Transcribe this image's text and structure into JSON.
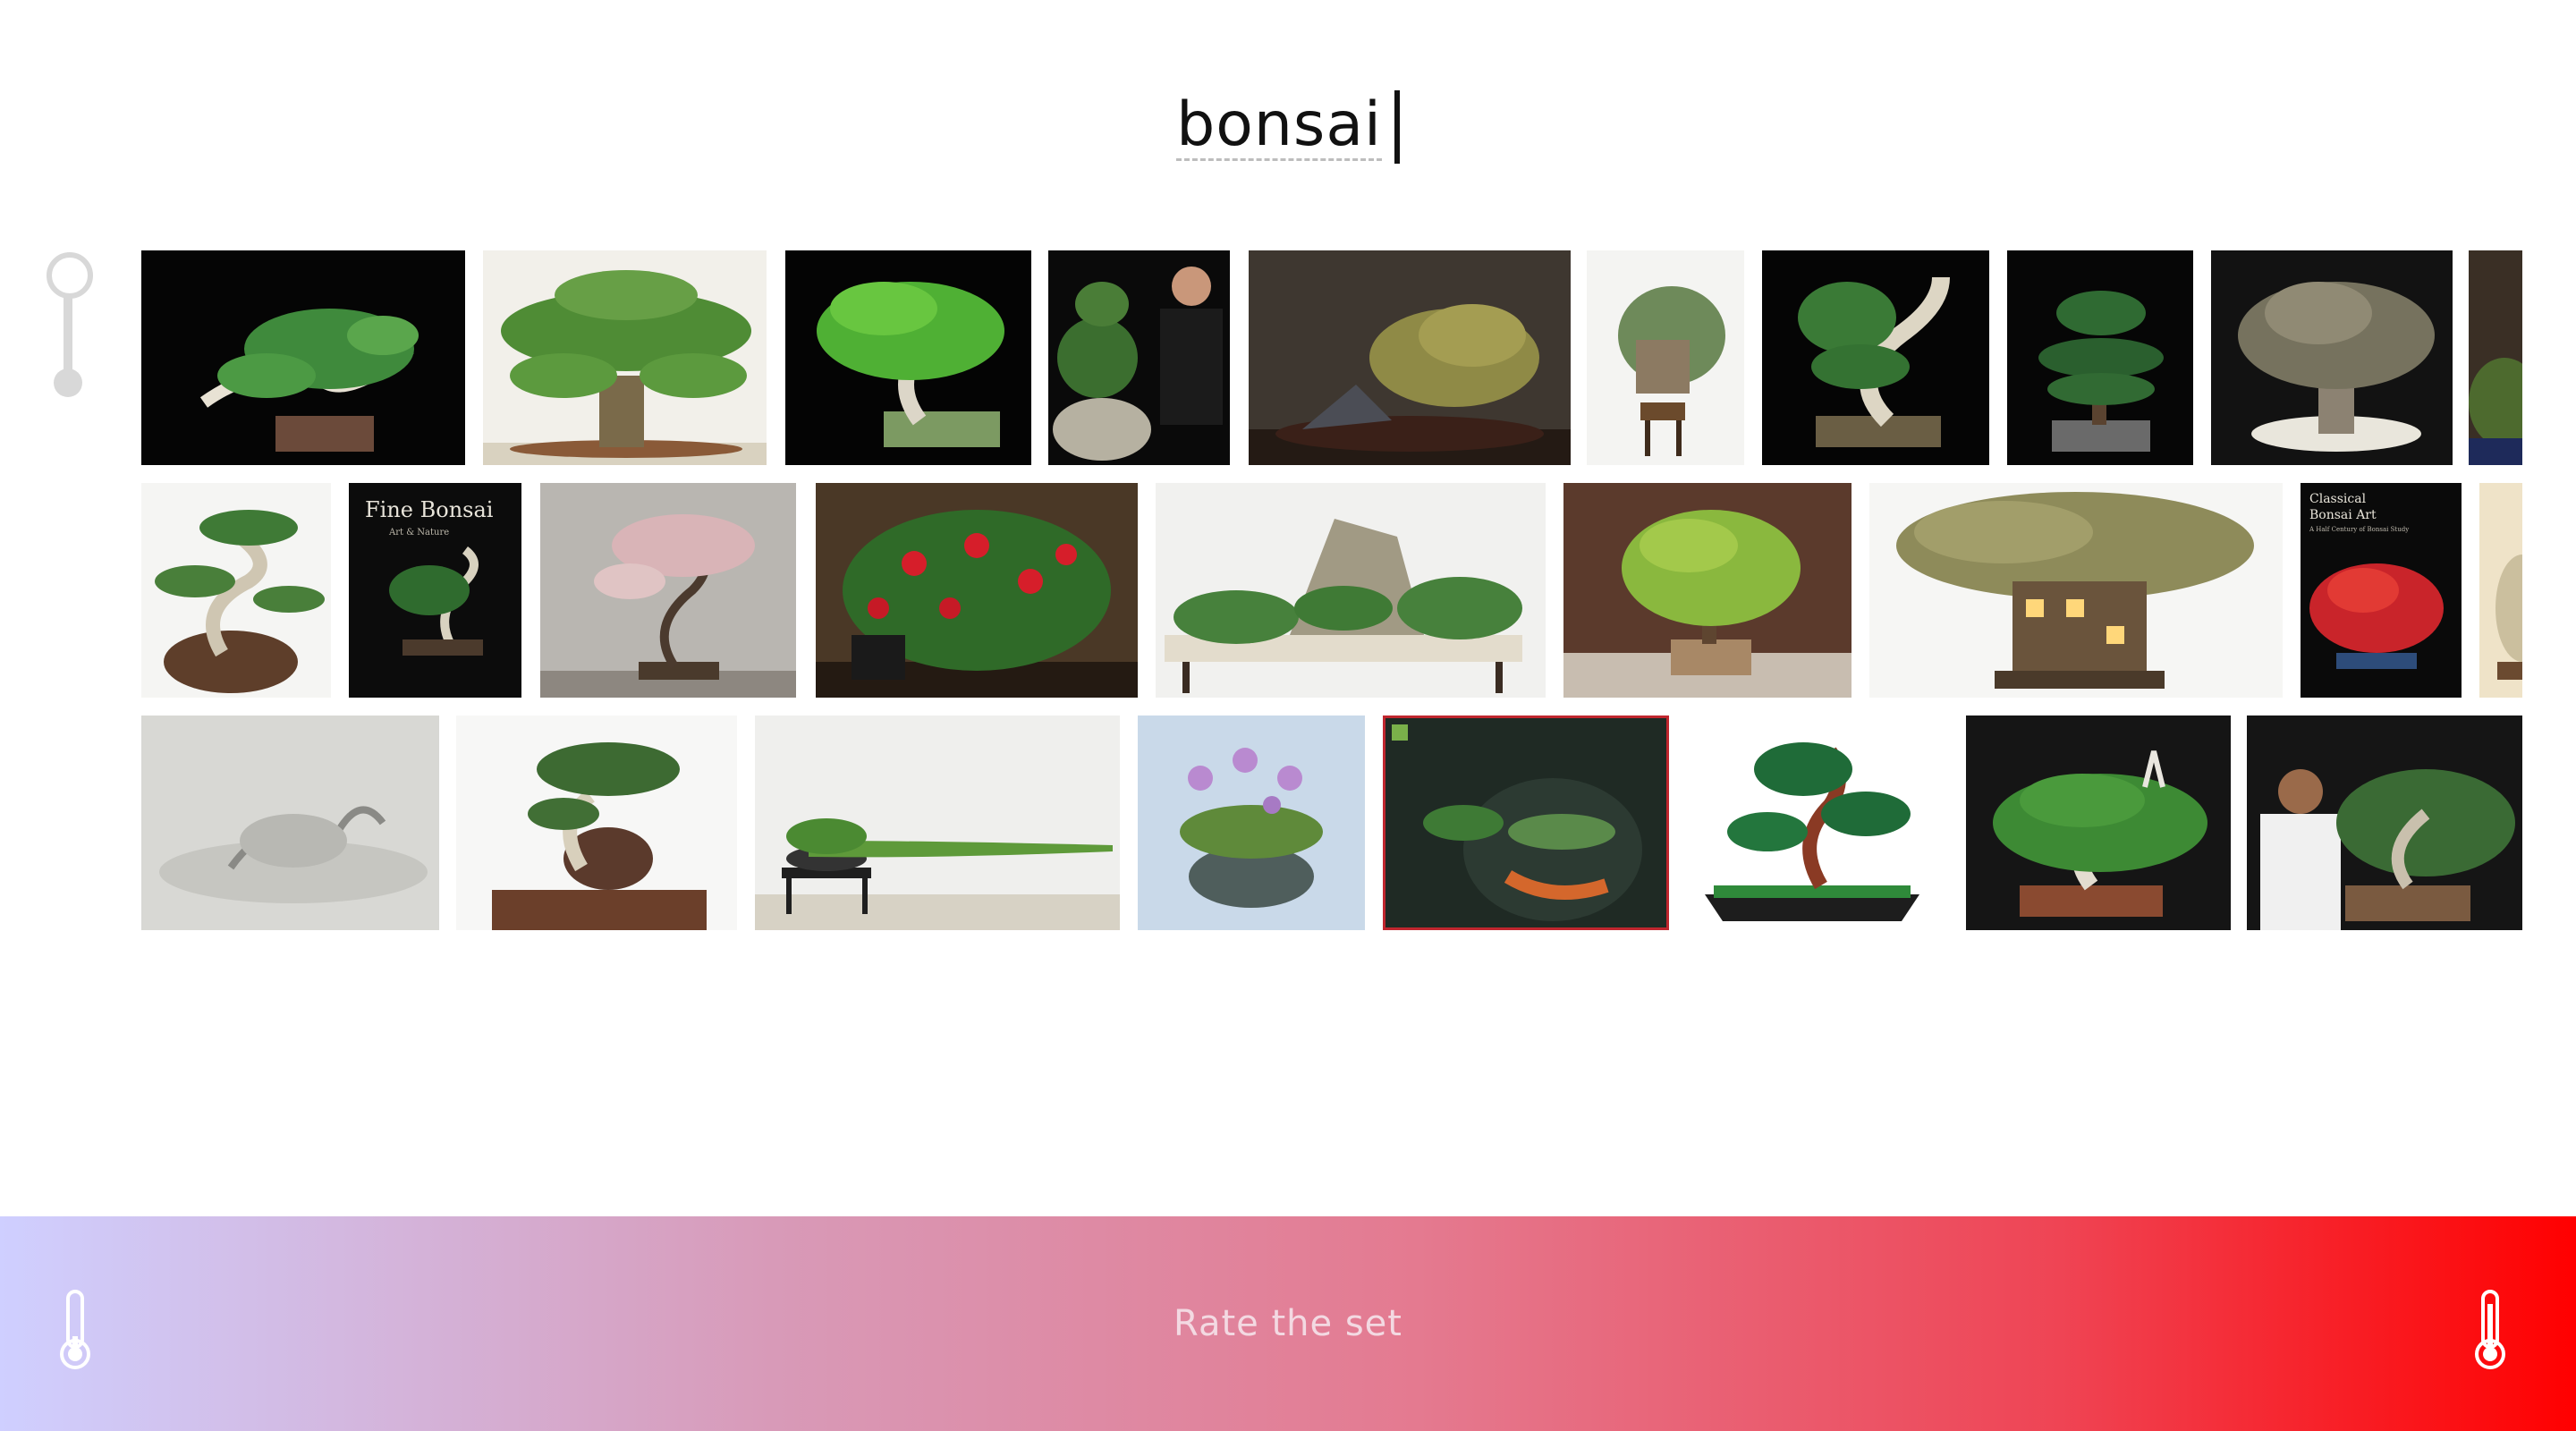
{
  "search": {
    "query": "bonsai"
  },
  "footer": {
    "label": "Rate the set"
  },
  "book_covers": {
    "fine_bonsai": {
      "title": "Fine Bonsai",
      "subtitle": "Art & Nature"
    },
    "classical": {
      "title_line1": "Classical",
      "title_line2": "Bonsai Art",
      "subtitle": "A Half Century of Bonsai Study"
    }
  },
  "colors": {
    "gradient_start": "#cfcfff",
    "gradient_end": "#ff0000",
    "slider": "#d8d8d8"
  },
  "icons": [
    "slider-icon",
    "thermometer-cold-icon",
    "thermometer-hot-icon"
  ]
}
